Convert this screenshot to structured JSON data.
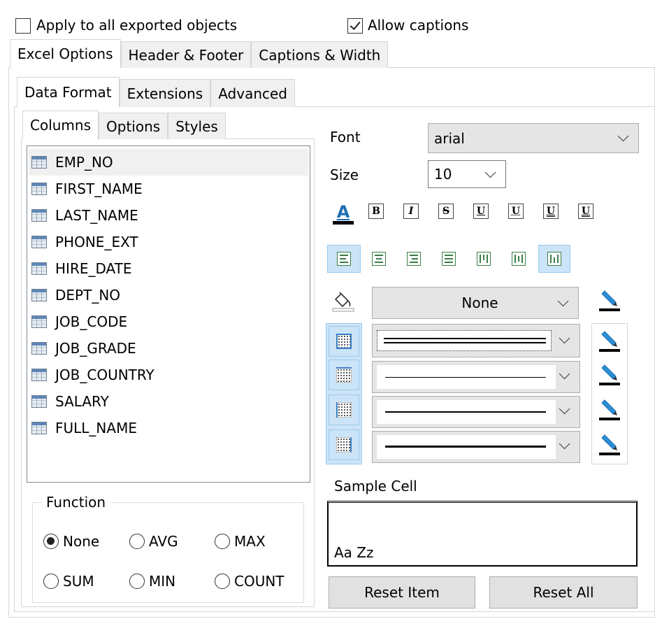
{
  "top": {
    "apply_all": {
      "label": "Apply to all exported objects",
      "checked": false
    },
    "allow_captions": {
      "label": "Allow captions",
      "checked": true
    }
  },
  "main_tabs": [
    "Excel Options",
    "Header & Footer",
    "Captions & Width"
  ],
  "sub_tabs": [
    "Data Format",
    "Extensions",
    "Advanced"
  ],
  "inner_tabs": [
    "Columns",
    "Options",
    "Styles"
  ],
  "columns": [
    "EMP_NO",
    "FIRST_NAME",
    "LAST_NAME",
    "PHONE_EXT",
    "HIRE_DATE",
    "DEPT_NO",
    "JOB_CODE",
    "JOB_GRADE",
    "JOB_COUNTRY",
    "SALARY",
    "FULL_NAME"
  ],
  "selected_column": "EMP_NO",
  "function_group": {
    "title": "Function",
    "options": [
      "None",
      "AVG",
      "MAX",
      "SUM",
      "MIN",
      "COUNT"
    ],
    "selected": "None"
  },
  "font": {
    "label": "Font",
    "value": "arial"
  },
  "size": {
    "label": "Size",
    "value": "10"
  },
  "fill": {
    "value": "None"
  },
  "sample": {
    "label": "Sample Cell",
    "text": "Aa Zz"
  },
  "buttons": {
    "reset_item": "Reset Item",
    "reset_all": "Reset All"
  },
  "format_glyphs": {
    "font_color": "A",
    "bold": "B",
    "italic": "I",
    "strike": "S",
    "underline_single": "U",
    "underline_acct": "U",
    "underline_double": "U",
    "underline_double_acct": "U"
  },
  "colors": {
    "accent": "#cce4f7",
    "pen_blue": "#1f6fb5",
    "pen_body": "#2a8fd6"
  }
}
